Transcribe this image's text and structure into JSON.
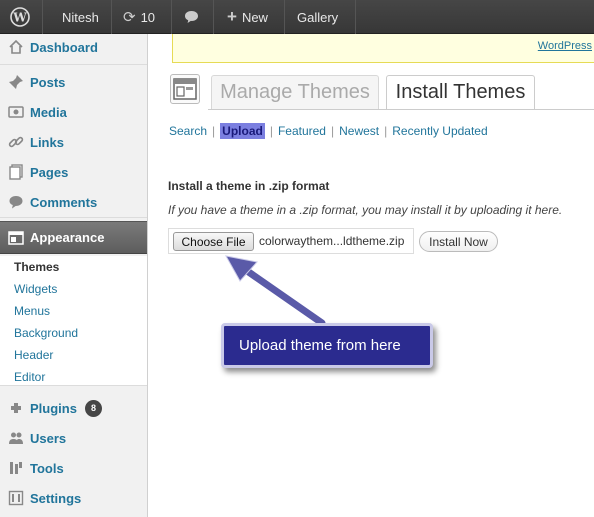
{
  "adminbar": {
    "wp_logo": "wordpress-logo",
    "user": "Nitesh",
    "updates_count": "10",
    "new_label": "New",
    "gallery_label": "Gallery"
  },
  "sidebar": {
    "items": [
      {
        "label": "Dashboard",
        "icon": "dashboard-icon"
      },
      {
        "label": "Posts",
        "icon": "posts-pin-icon"
      },
      {
        "label": "Media",
        "icon": "media-icon"
      },
      {
        "label": "Links",
        "icon": "links-icon"
      },
      {
        "label": "Pages",
        "icon": "pages-icon"
      },
      {
        "label": "Comments",
        "icon": "comments-icon"
      },
      {
        "label": "Appearance",
        "icon": "appearance-icon"
      },
      {
        "label": "Plugins",
        "icon": "plugins-icon",
        "badge": "8"
      },
      {
        "label": "Users",
        "icon": "users-icon"
      },
      {
        "label": "Tools",
        "icon": "tools-icon"
      },
      {
        "label": "Settings",
        "icon": "settings-icon"
      }
    ],
    "submenu": [
      "Themes",
      "Widgets",
      "Menus",
      "Background",
      "Header",
      "Editor"
    ]
  },
  "notice": {
    "link_text": "WordPress"
  },
  "tabs": {
    "manage": "Manage Themes",
    "install": "Install Themes"
  },
  "filters": {
    "search": "Search",
    "upload": "Upload",
    "featured": "Featured",
    "newest": "Newest",
    "recently_updated": "Recently Updated",
    "separator": "|"
  },
  "upload_form": {
    "title": "Install a theme in .zip format",
    "description": "If you have a theme in a .zip format, you may install it by uploading it here.",
    "choose_file": "Choose File",
    "file_name": "colorwaythem...ldtheme.zip",
    "install_now": "Install Now"
  },
  "callout": {
    "text": "Upload theme from here"
  },
  "colors": {
    "link": "#21759b",
    "adminbar": "#464646",
    "callout_bg": "#2b2b8f",
    "arrow": "#5a5aa8",
    "notice_bg": "#ffffe0"
  }
}
